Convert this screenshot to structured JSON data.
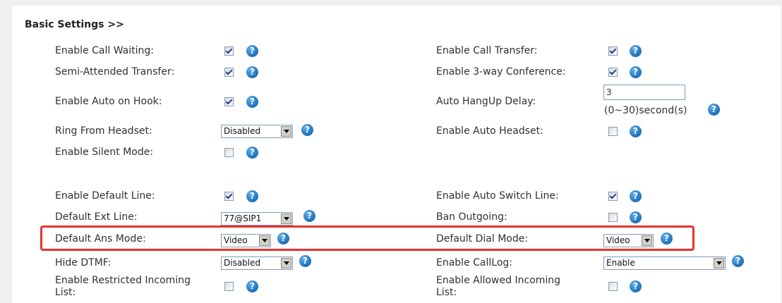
{
  "section_title": "Basic Settings >>",
  "help_glyph": "?",
  "left": {
    "call_waiting": {
      "label": "Enable Call Waiting:",
      "checked": true
    },
    "semi_attended": {
      "label": "Semi-Attended Transfer:",
      "checked": true
    },
    "auto_on_hook": {
      "label": "Enable Auto on Hook:",
      "checked": true
    },
    "ring_headset": {
      "label": "Ring From Headset:",
      "value": "Disabled"
    },
    "silent_mode": {
      "label": "Enable Silent Mode:",
      "checked": false
    },
    "default_line": {
      "label": "Enable Default Line:",
      "checked": true
    },
    "ext_line": {
      "label": "Default Ext Line:",
      "value": "77@SIP1"
    },
    "ans_mode": {
      "label": "Default Ans Mode:",
      "value": "Video"
    },
    "hide_dtmf": {
      "label": "Hide DTMF:",
      "value": "Disabled"
    },
    "restricted_incoming": {
      "label_line1": "Enable Restricted Incoming",
      "label_line2": "List:",
      "checked": false
    }
  },
  "right": {
    "call_transfer": {
      "label": "Enable Call Transfer:",
      "checked": true
    },
    "three_way": {
      "label": "Enable 3-way Conference:",
      "checked": true
    },
    "hangup_delay": {
      "label": "Auto HangUp Delay:",
      "value": "3",
      "hint": "(0~30)second(s)"
    },
    "auto_headset": {
      "label": "Enable Auto Headset:",
      "checked": false
    },
    "auto_switch": {
      "label": "Enable Auto Switch Line:",
      "checked": true
    },
    "ban_outgoing": {
      "label": "Ban Outgoing:",
      "checked": false
    },
    "dial_mode": {
      "label": "Default Dial Mode:",
      "value": "Video"
    },
    "calllog": {
      "label": "Enable CallLog:",
      "value": "Enable"
    },
    "allowed_incoming": {
      "label_line1": "Enable Allowed Incoming",
      "label_line2": "List:",
      "checked": false
    }
  },
  "highlight_color": "#e8332b",
  "help_color": "#1d6fb8"
}
